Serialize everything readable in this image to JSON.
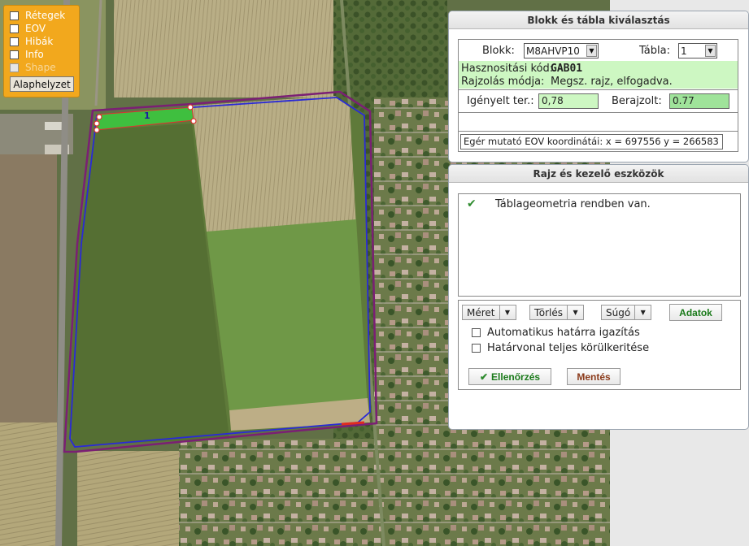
{
  "layers": {
    "items": [
      {
        "label": "Rétegek",
        "checked": false,
        "enabled": true
      },
      {
        "label": "EOV",
        "checked": false,
        "enabled": true
      },
      {
        "label": "Hibák",
        "checked": false,
        "enabled": true
      },
      {
        "label": "Info",
        "checked": false,
        "enabled": true
      },
      {
        "label": "Shape",
        "checked": false,
        "enabled": false
      }
    ],
    "reset_label": "Alaphelyzet"
  },
  "map": {
    "parcel_label": "1",
    "colors": {
      "parcel_outline": "#7b1f74",
      "drawn_outline": "#2a2ad6",
      "selection_fill": "#3fbf3f",
      "vertex": "#e03030",
      "orange_accent": "#f2a81d"
    }
  },
  "blokk_panel": {
    "title": "Blokk és tábla kiválasztás",
    "blokk_label": "Blokk:",
    "blokk_value": "M8AHVP10",
    "tabla_label": "Tábla:",
    "tabla_value": "1",
    "hasznositasi_label": "Hasznositási kód:",
    "hasznositasi_value": "GAB01",
    "rajzolas_label": "Rajzolás módja:",
    "rajzolas_value": "Megsz. rajz, elfogadva.",
    "igenyelt_label": "Igényelt ter.:",
    "igenyelt_value": "0,78",
    "berajzolt_label": "Berajzolt:",
    "berajzolt_value": "0.77",
    "coords_text": "Egér mutató EOV koordinátái: x = 697556  y = 266583"
  },
  "rajz_panel": {
    "title": "Rajz és kezelő eszközök",
    "status_icon": "check-icon",
    "status_text": "Táblageometria rendben van.",
    "tools": {
      "meret": "Méret",
      "torles": "Törlés",
      "sugo": "Súgó",
      "adatok": "Adatok"
    },
    "options": [
      {
        "label": "Automatikus határra igazítás",
        "checked": false
      },
      {
        "label": "Határvonal teljes körülkeritése",
        "checked": false
      }
    ],
    "ellenorzes_label": "Ellenőrzés",
    "mentes_label": "Mentés",
    "colors": {
      "adatok": "#1a7a1a",
      "mentes": "#8b3a1a",
      "check": "#2e8b2e"
    }
  }
}
